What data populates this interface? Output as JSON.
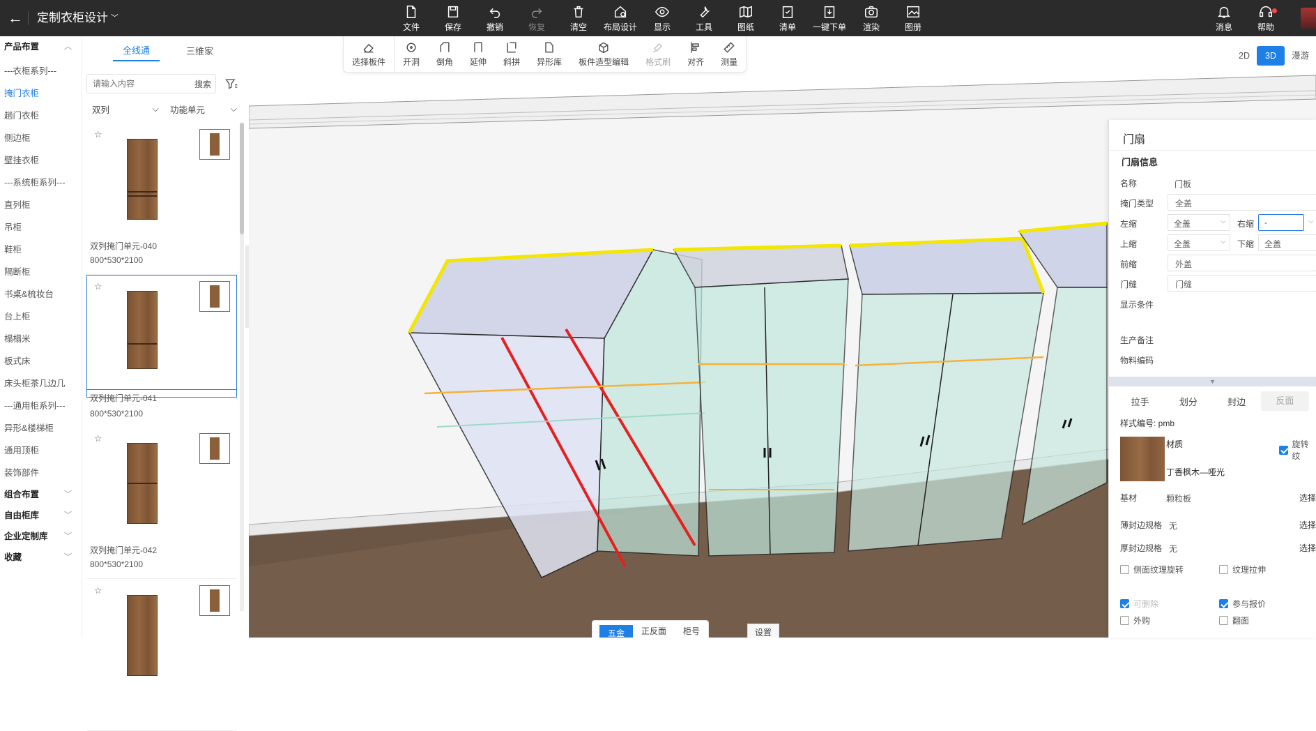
{
  "app": {
    "back_icon": "arrow-left-icon",
    "title": "定制衣柜设计"
  },
  "top_tools": [
    {
      "label": "文件",
      "icon": "file-icon"
    },
    {
      "label": "保存",
      "icon": "save-icon"
    },
    {
      "label": "撤销",
      "icon": "undo-icon"
    },
    {
      "label": "恢复",
      "icon": "redo-icon"
    },
    {
      "label": "清空",
      "icon": "trash-icon"
    },
    {
      "label": "布局设计",
      "icon": "layout-icon"
    },
    {
      "label": "显示",
      "icon": "eye-icon"
    },
    {
      "label": "工具",
      "icon": "wrench-icon"
    },
    {
      "label": "图纸",
      "icon": "map-icon"
    },
    {
      "label": "清单",
      "icon": "clipboard-icon"
    },
    {
      "label": "一键下单",
      "icon": "download-order-icon"
    },
    {
      "label": "渲染",
      "icon": "camera-icon"
    },
    {
      "label": "图册",
      "icon": "album-icon"
    }
  ],
  "top_right": {
    "messages": "消息",
    "help": "帮助"
  },
  "categories": [
    {
      "label": "产品布置",
      "bold": true,
      "chevron": "︿"
    },
    {
      "label": "---衣柜系列---"
    },
    {
      "label": "掩门衣柜",
      "active": true
    },
    {
      "label": "趟门衣柜"
    },
    {
      "label": "侧边柜"
    },
    {
      "label": "壁挂衣柜"
    },
    {
      "label": "---系统柜系列---"
    },
    {
      "label": "直列柜"
    },
    {
      "label": "吊柜"
    },
    {
      "label": "鞋柜"
    },
    {
      "label": "隔断柜"
    },
    {
      "label": "书桌&梳妆台"
    },
    {
      "label": "台上柜"
    },
    {
      "label": "榻榻米"
    },
    {
      "label": "板式床"
    },
    {
      "label": "床头柜茶几边几"
    },
    {
      "label": "---通用柜系列---"
    },
    {
      "label": "异形&楼梯柜"
    },
    {
      "label": "通用顶柜"
    },
    {
      "label": "装饰部件"
    },
    {
      "label": "组合布置",
      "bold": true,
      "chevron": "﹀"
    },
    {
      "label": "自由柜库",
      "bold": true,
      "chevron": "﹀"
    },
    {
      "label": "企业定制库",
      "bold": true,
      "chevron": "﹀"
    },
    {
      "label": "收藏",
      "bold": true,
      "chevron": "﹀"
    }
  ],
  "product_panel": {
    "tabs": [
      "全线通",
      "三维家"
    ],
    "search_placeholder": "请输入内容",
    "search_button": "搜索",
    "select1": "双列",
    "select2": "功能单元",
    "cards": [
      {
        "name": "双列掩门单元-040",
        "size": "800*530*2100"
      },
      {
        "name": "双列掩门单元-041",
        "size": "800*530*2100"
      },
      {
        "name": "双列掩门单元-042",
        "size": "800*530*2100"
      },
      {
        "name": "",
        "size": ""
      }
    ]
  },
  "viewport_toolbar": [
    {
      "label": "选择板件",
      "icon": "eraser-icon"
    },
    {
      "label": "开洞",
      "icon": "hole-icon"
    },
    {
      "label": "倒角",
      "icon": "chamfer-icon"
    },
    {
      "label": "延伸",
      "icon": "extend-icon"
    },
    {
      "label": "斜拼",
      "icon": "diagonal-join-icon"
    },
    {
      "label": "异形库",
      "icon": "shape-library-icon"
    },
    {
      "label": "板件造型编辑",
      "icon": "panel-shape-edit-icon"
    },
    {
      "label": "格式刷",
      "icon": "format-brush-icon"
    },
    {
      "label": "对齐",
      "icon": "align-icon"
    },
    {
      "label": "测量",
      "icon": "ruler-icon"
    }
  ],
  "view_modes": [
    "2D",
    "3D",
    "漫游"
  ],
  "properties": {
    "title": "门扇",
    "section": "门扇信息",
    "name_label": "名称",
    "name_value": "门板",
    "door_type_label": "掩门类型",
    "door_type_value": "全盖",
    "left_label": "左缩",
    "left_value": "全盖",
    "right_label": "右缩",
    "right_value": "-",
    "top_label": "上缩",
    "top_value": "全盖",
    "bottom_label": "下缩",
    "bottom_value": "全盖",
    "front_label": "前缩",
    "front_value": "外盖",
    "gap_label": "门缝",
    "gap_value": "门缝",
    "display_cond_label": "显示条件",
    "prod_note_label": "生产备注",
    "material_code_label": "物料编码",
    "subtabs": [
      "拉手",
      "划分",
      "封边",
      "反面"
    ],
    "style_code": "样式编号: pmb",
    "material_label": "材质",
    "material_value": "丁香枫木—哑光",
    "rotate_texture": "旋转纹",
    "base_label": "基材",
    "base_value": "颗粒板",
    "thin_edge_label": "薄封边规格",
    "thin_edge_value": "无",
    "thick_edge_label": "厚封边规格",
    "thick_edge_value": "无",
    "choose": "选择",
    "side_texture_rotate": "侧面纹理旋转",
    "texture_stretch": "纹理拉伸",
    "deletable": "可删除",
    "join_quote": "参与报价",
    "outsource": "外购",
    "flip": "翻面"
  },
  "bottom_tabs": [
    "五金",
    "正反面",
    "柜号"
  ],
  "settings_button": "设置"
}
